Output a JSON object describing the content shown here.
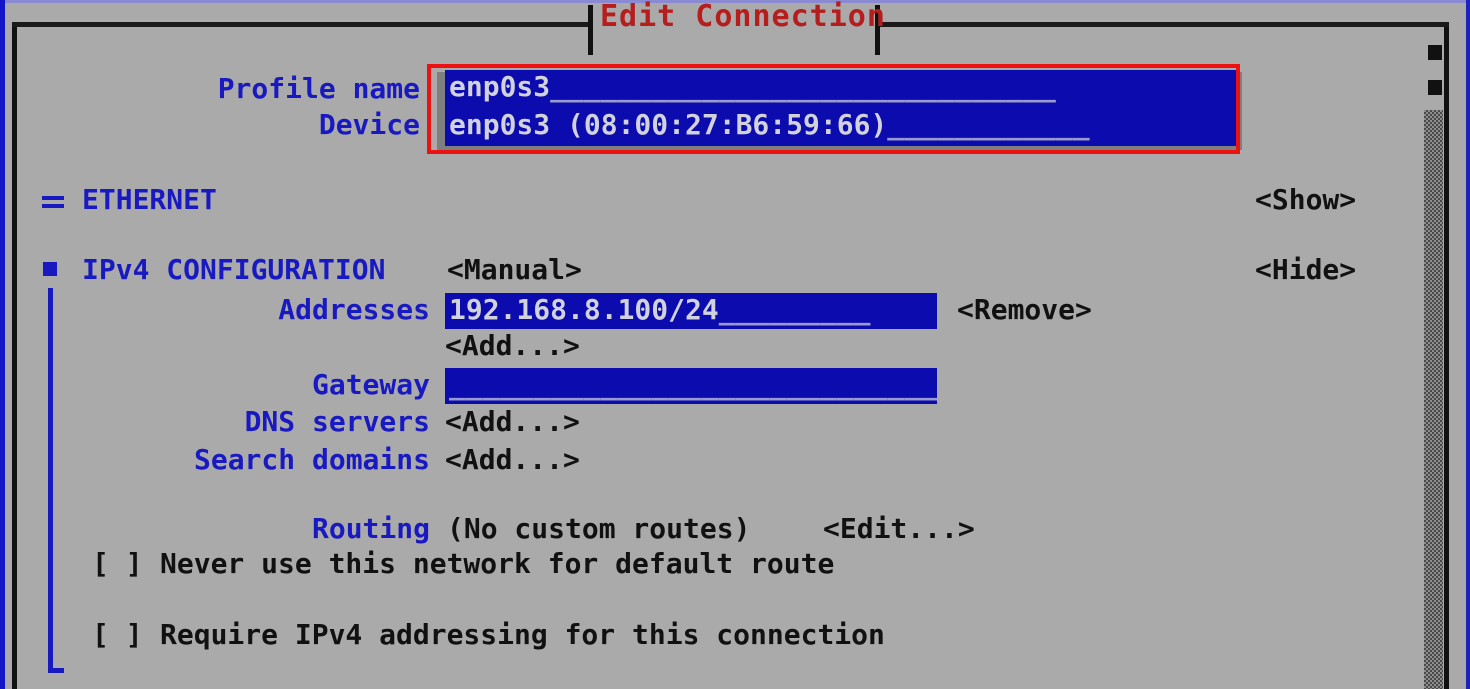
{
  "window": {
    "title": "Edit Connection",
    "title_color": "#b61d1d",
    "background_color": "#aaaaaa",
    "label_color": "#1919c1",
    "field_background": "#0b0bae",
    "field_text_color": "#d2d2dc",
    "annotation_color": "#ee1111"
  },
  "form": {
    "profile_name": {
      "label": "Profile name",
      "value": "enp0s3",
      "fill": "______________________________"
    },
    "device": {
      "label": "Device",
      "value": "enp0s3 (08:00:27:B6:59:66)",
      "fill": "____________"
    }
  },
  "sections": {
    "ethernet": {
      "marker": "=",
      "label": "ETHERNET",
      "toggle": "<Show>"
    },
    "ipv4": {
      "marker": "▪",
      "label": "IPv4 CONFIGURATION",
      "mode": "<Manual>",
      "toggle": "<Hide>"
    }
  },
  "ipv4": {
    "addresses": {
      "label": "Addresses",
      "value": "192.168.8.100/24",
      "fill": "_________",
      "remove_button": "<Remove>",
      "add_button": "<Add...>"
    },
    "gateway": {
      "label": "Gateway",
      "value": "",
      "fill": "______________________________"
    },
    "dns_servers": {
      "label": "DNS servers",
      "add_button": "<Add...>"
    },
    "search_domains": {
      "label": "Search domains",
      "add_button": "<Add...>"
    },
    "routing": {
      "label": "Routing",
      "status": "(No custom routes)",
      "edit_button": "<Edit...>"
    },
    "never_default": {
      "checkbox": "[ ]",
      "label": "Never use this network for default route",
      "checked": false
    },
    "require_ipv4": {
      "checkbox": "[ ]",
      "label": "Require IPv4 addressing for this connection",
      "checked": false
    }
  },
  "scrollbar": {
    "name": "vertical-scrollbar"
  }
}
